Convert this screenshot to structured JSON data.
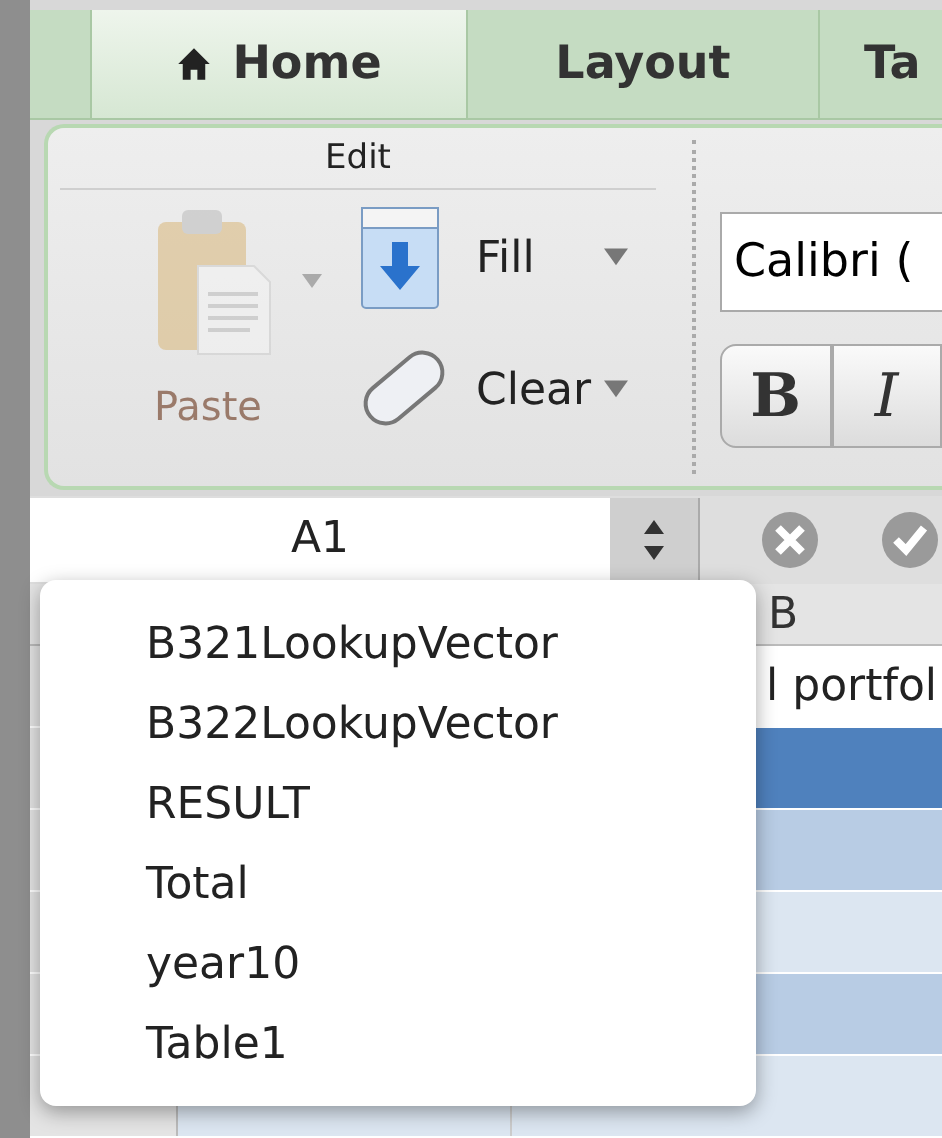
{
  "ribbon": {
    "tabs": [
      {
        "label": "Home",
        "selected": true
      },
      {
        "label": "Layout",
        "selected": false
      },
      {
        "label": "Ta",
        "selected": false
      }
    ],
    "group_title": "Edit",
    "paste": {
      "label": "Paste",
      "disabled": true
    },
    "fill": "Fill",
    "clear": "Clear",
    "font_field": {
      "value": "Calibri ("
    },
    "format_buttons": [
      {
        "label": "B",
        "kind": "bold"
      },
      {
        "label": "I",
        "kind": "italic"
      }
    ]
  },
  "formula_bar": {
    "name_box": "A1"
  },
  "sheet": {
    "column_header": "B",
    "cell": "l portfol",
    "rows": [
      {
        "kind": "plain"
      },
      {
        "kind": "header"
      },
      {
        "kind": "band"
      },
      {
        "kind": "light"
      },
      {
        "kind": "band"
      },
      {
        "kind": "light"
      }
    ]
  },
  "name_menu": {
    "items": [
      "B321LookupVector",
      "B322LookupVector",
      "RESULT",
      "Total",
      "year10",
      "Table1"
    ]
  }
}
